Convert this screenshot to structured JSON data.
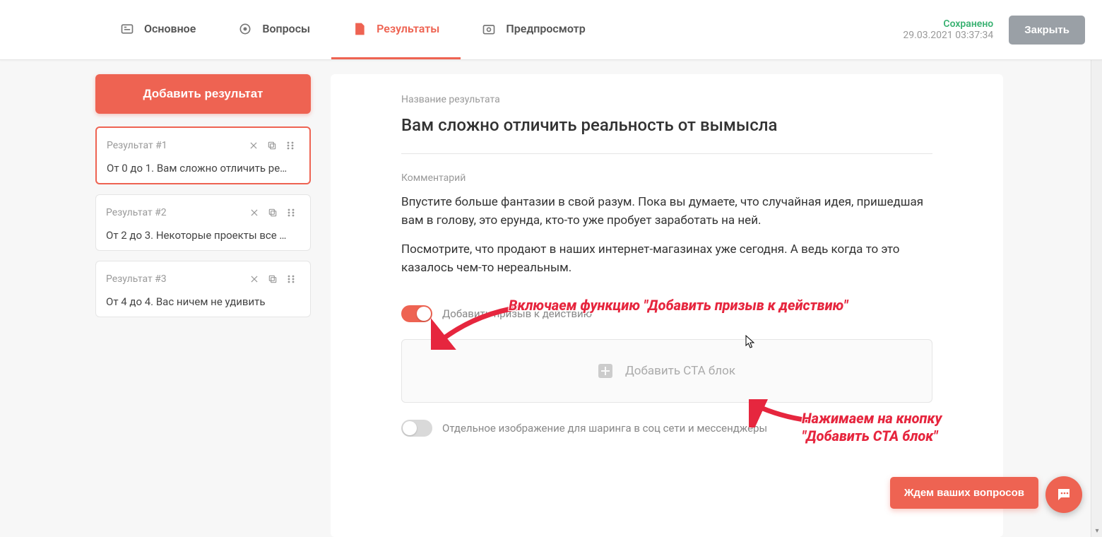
{
  "topbar": {
    "tabs": [
      {
        "label": "Основное"
      },
      {
        "label": "Вопросы"
      },
      {
        "label": "Результаты"
      },
      {
        "label": "Предпросмотр"
      }
    ],
    "saved_label": "Сохранено",
    "saved_time": "29.03.2021 03:37:34",
    "close_label": "Закрыть"
  },
  "sidebar": {
    "add_label": "Добавить результат",
    "items": [
      {
        "title": "Результат #1",
        "desc": "От 0 до 1.  Вам сложно отличить ре…"
      },
      {
        "title": "Результат #2",
        "desc": "От 2 до 3.  Некоторые проекты все …"
      },
      {
        "title": "Результат #3",
        "desc": "От 4 до 4.  Вас ничем не удивить"
      }
    ]
  },
  "main": {
    "title_label": "Название результата",
    "title_value": "Вам сложно отличить реальность от вымысла",
    "comment_label": "Комментарий",
    "comment_p1": "Впустите больше фантазии в свой разум. Пока вы думаете, что случайная идея, пришедшая вам в голову, это ерунда, кто-то уже пробует заработать на ней.",
    "comment_p2": "Посмотрите, что продают в наших интернет-магазинах уже сегодня. А ведь когда то это казалось чем-то нереальным.",
    "cta_toggle_label": "Добавить призыв к действию",
    "cta_add_label": "Добавить CTA блок",
    "share_img_label": "Отдельное изображение для шаринга в соц сети и мессенджеры"
  },
  "float": {
    "ask": "Ждем ваших вопросов"
  },
  "annotations": {
    "a1": "Включаем функцию \"Добавить призыв к действию\"",
    "a2_l1": "Нажимаем на кнопку",
    "a2_l2": "\"Добавить CTA блок\""
  }
}
